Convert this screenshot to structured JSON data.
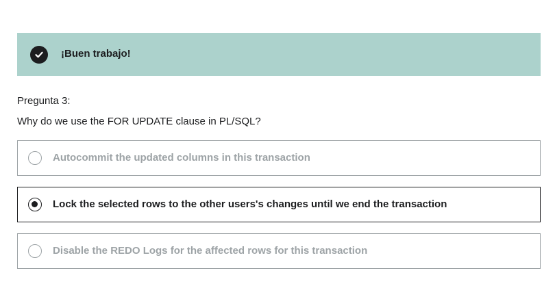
{
  "feedback": {
    "title": "¡Buen trabajo!",
    "icon": "check-circle-icon",
    "background_color": "#acd2cc"
  },
  "question": {
    "number_label": "Pregunta 3:",
    "text": "Why do we use the FOR UPDATE clause in PL/SQL?"
  },
  "options": [
    {
      "label": "Autocommit the updated columns in this transaction",
      "selected": false
    },
    {
      "label": "Lock the selected rows to the other users's changes until we end the transaction",
      "selected": true
    },
    {
      "label": "Disable the REDO Logs for the affected rows for this transaction",
      "selected": false
    }
  ]
}
